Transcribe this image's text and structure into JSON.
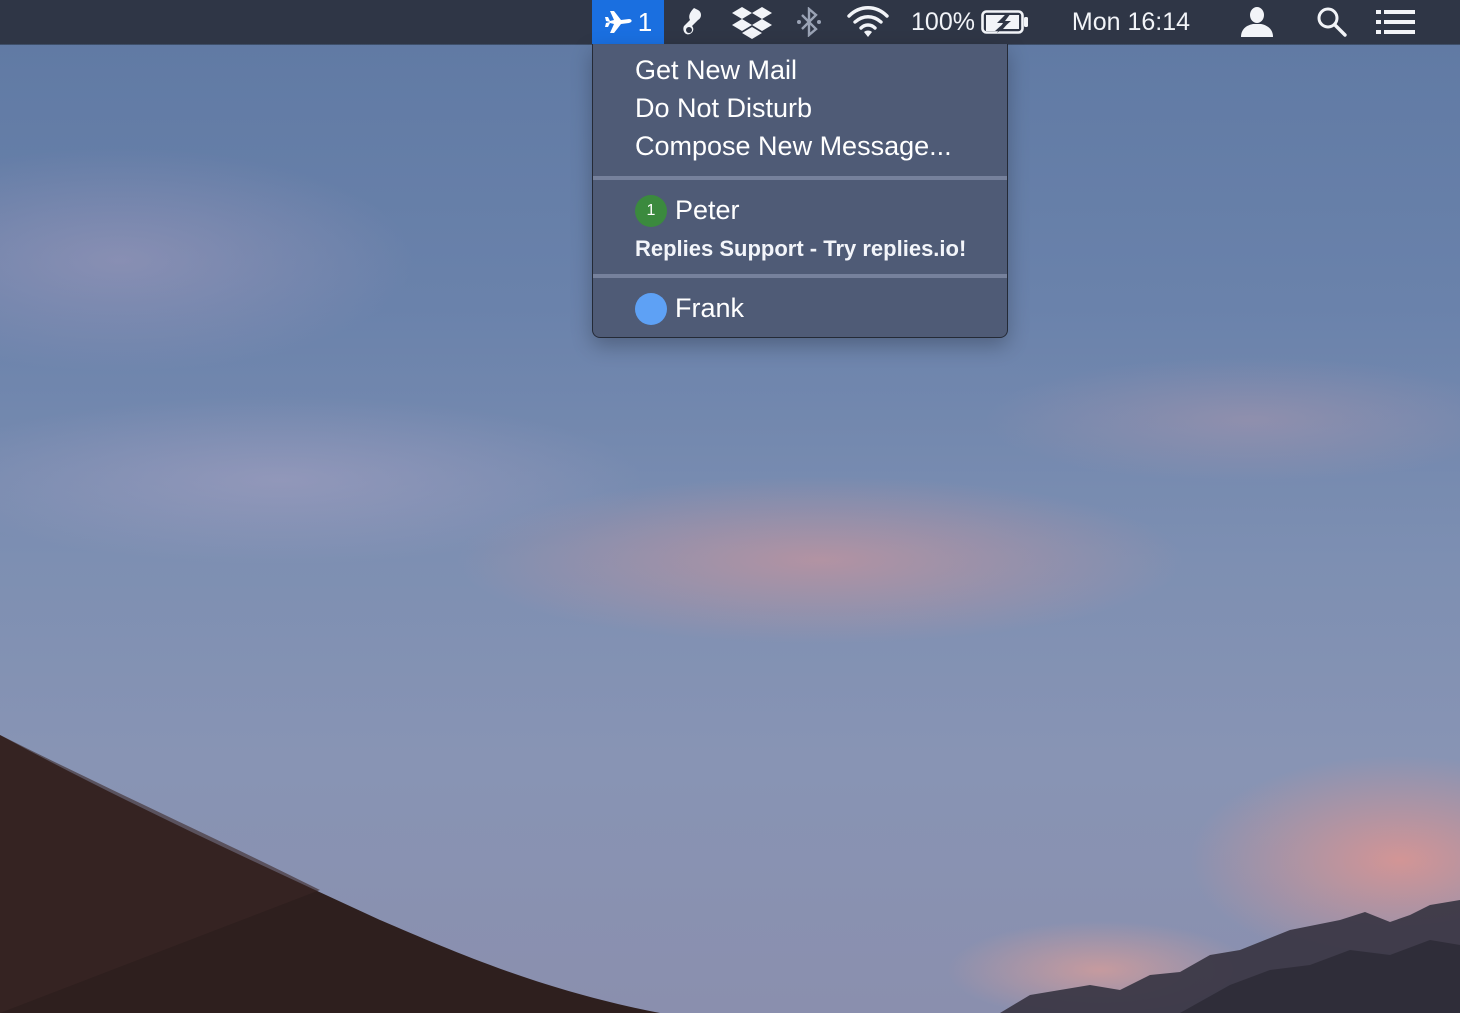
{
  "menubar": {
    "app_icon": "airplane-mail-icon",
    "app_count": "1",
    "battery_percent": "100%",
    "clock": "Mon 16:14",
    "icons": [
      "airplane-mail-icon",
      "scissors-clip-icon",
      "dropbox-icon",
      "bluetooth-icon",
      "wifi-icon",
      "battery-charging-icon",
      "user-icon",
      "search-icon",
      "list-icon"
    ]
  },
  "menu": {
    "actions": [
      {
        "label": "Get New Mail"
      },
      {
        "label": "Do Not Disturb"
      },
      {
        "label": "Compose New Message..."
      }
    ],
    "accounts": [
      {
        "name": "Peter",
        "badge": "1",
        "badge_color": "#3b8a3e",
        "subtitle": "Replies Support - Try replies.io!"
      },
      {
        "name": "Frank",
        "badge": "",
        "badge_color": "#5ea1f5"
      }
    ]
  },
  "colors": {
    "menubar_bg": "#2f3646",
    "app_highlight": "#1a6fe0",
    "menu_bg": "#4e5a74"
  }
}
